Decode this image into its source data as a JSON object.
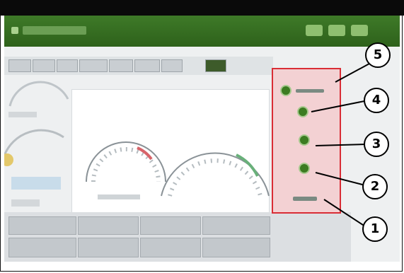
{
  "callouts": [
    {
      "number": "5"
    },
    {
      "number": "4"
    },
    {
      "number": "3"
    },
    {
      "number": "2"
    },
    {
      "number": "1"
    }
  ],
  "colors": {
    "title_bar": "#2e611b",
    "highlight_box": "#d92d35",
    "highlight_fill": "#f3d1d3",
    "indicator": "#3c7c21"
  },
  "icons": {
    "indicator": "circle-icon"
  }
}
